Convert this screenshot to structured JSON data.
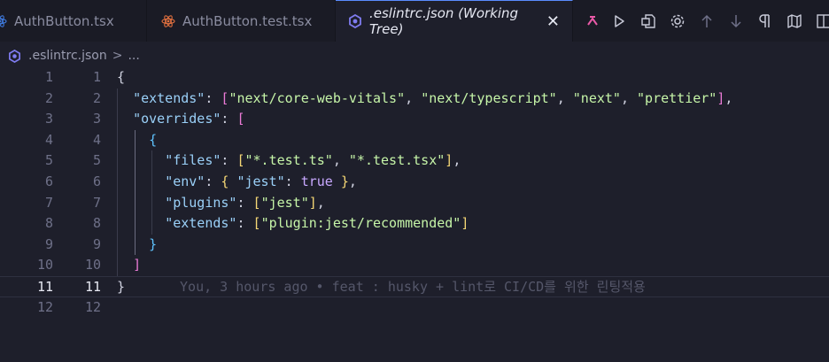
{
  "tabs": [
    {
      "label": "AuthButton.tsx",
      "icon": "react-icon",
      "active": false
    },
    {
      "label": "AuthButton.test.tsx",
      "icon": "react-icon",
      "active": false
    },
    {
      "label": ".eslintrc.json (Working Tree)",
      "icon": "eslint-icon",
      "active": true
    },
    {
      "label": "",
      "icon": "diff-icon",
      "active": false
    }
  ],
  "toolbar": {
    "actions": [
      "run-icon",
      "open-changes-icon",
      "settings-icon",
      "arrow-up-icon",
      "arrow-down-icon",
      "pilcrow-icon",
      "map-icon",
      "split-editor-icon"
    ]
  },
  "breadcrumb": {
    "file": ".eslintrc.json",
    "separator": ">",
    "more": "..."
  },
  "editor": {
    "current_line": 11,
    "lines": [
      {
        "n1": "1",
        "n2": "1",
        "text": "{"
      },
      {
        "n1": "2",
        "n2": "2",
        "text": "  \"extends\": [\"next/core-web-vitals\", \"next/typescript\", \"next\", \"prettier\"],"
      },
      {
        "n1": "3",
        "n2": "3",
        "text": "  \"overrides\": ["
      },
      {
        "n1": "4",
        "n2": "4",
        "text": "    {"
      },
      {
        "n1": "5",
        "n2": "5",
        "text": "      \"files\": [\"*.test.ts\", \"*.test.tsx\"],"
      },
      {
        "n1": "6",
        "n2": "6",
        "text": "      \"env\": { \"jest\": true },"
      },
      {
        "n1": "7",
        "n2": "7",
        "text": "      \"plugins\": [\"jest\"],"
      },
      {
        "n1": "8",
        "n2": "8",
        "text": "      \"extends\": [\"plugin:jest/recommended\"]"
      },
      {
        "n1": "9",
        "n2": "9",
        "text": "    }"
      },
      {
        "n1": "10",
        "n2": "10",
        "text": "  ]"
      },
      {
        "n1": "11",
        "n2": "11",
        "text": "}"
      },
      {
        "n1": "12",
        "n2": "12",
        "text": ""
      }
    ],
    "blame": "You, 3 hours ago • feat : husky + lint로 CI/CD를 위한 린팅적용"
  },
  "colors": {
    "background": "#1e1f2b",
    "tab_active_border": "#5a8cff",
    "string": "#c6f5a8",
    "key": "#9ad0f8",
    "keyword": "#c8a8ff",
    "bracket_level1": "#f5d775",
    "bracket_level2": "#ea7ad6",
    "bracket_level3": "#5fc3ff"
  }
}
